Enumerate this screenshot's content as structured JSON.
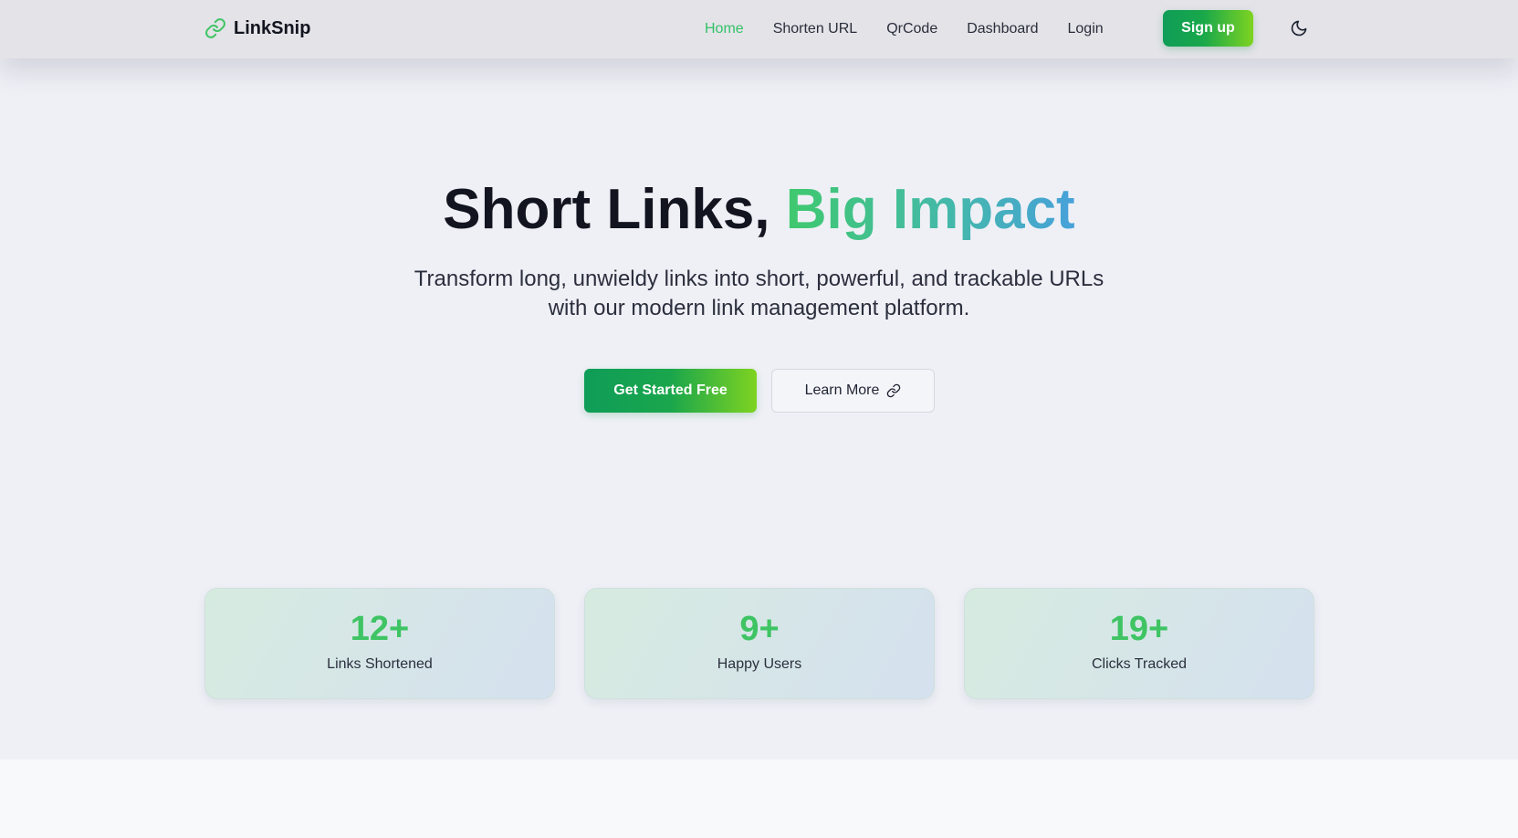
{
  "brand": {
    "name": "LinkSnip",
    "icon": "link-icon"
  },
  "nav": {
    "items": [
      {
        "label": "Home",
        "active": true
      },
      {
        "label": "Shorten URL",
        "active": false
      },
      {
        "label": "QrCode",
        "active": false
      },
      {
        "label": "Dashboard",
        "active": false
      },
      {
        "label": "Login",
        "active": false
      }
    ],
    "signup_label": "Sign up",
    "theme_icon": "moon-icon"
  },
  "hero": {
    "title_plain": "Short Links, ",
    "title_gradient": "Big Impact",
    "subtitle": "Transform long, unwieldy links into short, powerful, and trackable URLs with our modern link management platform.",
    "primary_cta": "Get Started Free",
    "secondary_cta": "Learn More",
    "secondary_icon": "link-icon"
  },
  "stats": [
    {
      "value": "12+",
      "label": "Links Shortened"
    },
    {
      "value": "9+",
      "label": "Happy Users"
    },
    {
      "value": "19+",
      "label": "Clicks Tracked"
    }
  ],
  "colors": {
    "accent_green": "#34c266",
    "gradient_start": "#0f9d58",
    "gradient_end": "#7ed321",
    "title_gradient_start": "#3fc96e",
    "title_gradient_end": "#47a1da",
    "background": "#eff0f6",
    "navbar": "#e3e3e8"
  }
}
